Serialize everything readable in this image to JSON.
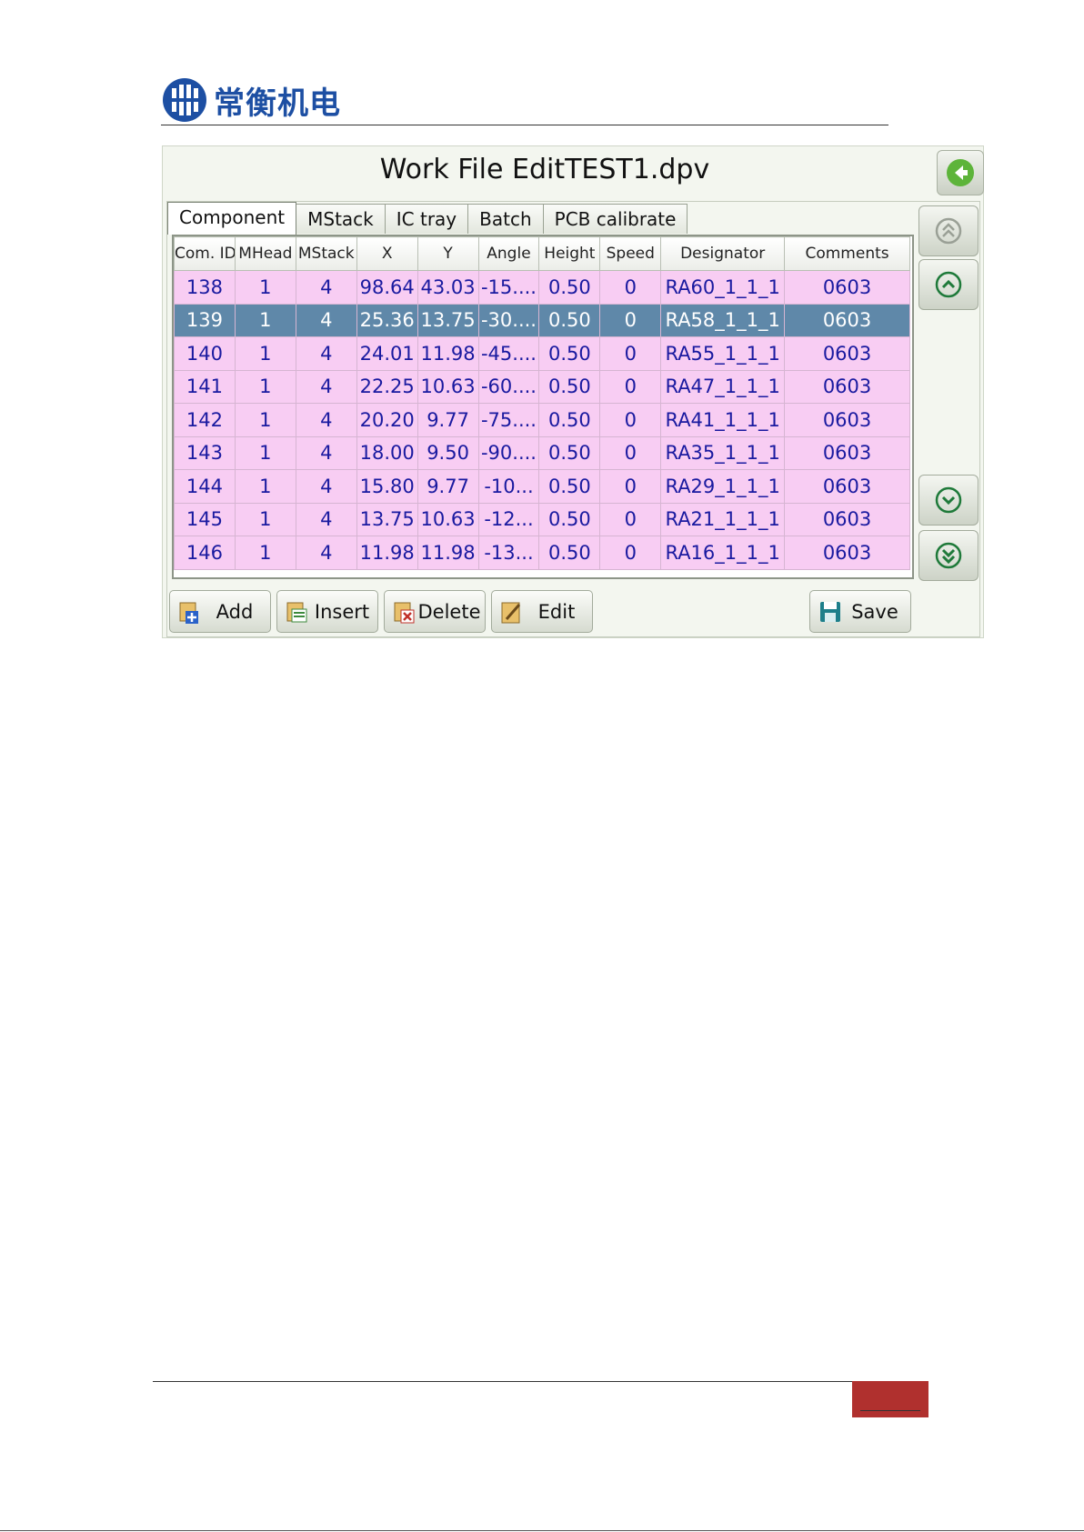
{
  "doc": {
    "logo_text": "常衡机电",
    "brand_color": "#1d4fa3",
    "footer_accent": "#b0302e"
  },
  "screen": {
    "title": "Work File EditTEST1.dpv",
    "tabs": [
      "Component",
      "MStack",
      "IC tray",
      "Batch",
      "PCB calibrate"
    ],
    "active_tab": "Component",
    "columns": [
      "Com. ID",
      "MHead",
      "MStack",
      "X",
      "Y",
      "Angle",
      "Height",
      "Speed",
      "Designator",
      "Comments"
    ],
    "rows": [
      {
        "id": "138",
        "mhead": "1",
        "mstack": "4",
        "x": "98.64",
        "y": "43.03",
        "angle": "-15....",
        "height": "0.50",
        "speed": "0",
        "designator": "RA60_1_1_1",
        "comments": "0603"
      },
      {
        "id": "139",
        "mhead": "1",
        "mstack": "4",
        "x": "25.36",
        "y": "13.75",
        "angle": "-30....",
        "height": "0.50",
        "speed": "0",
        "designator": "RA58_1_1_1",
        "comments": "0603"
      },
      {
        "id": "140",
        "mhead": "1",
        "mstack": "4",
        "x": "24.01",
        "y": "11.98",
        "angle": "-45....",
        "height": "0.50",
        "speed": "0",
        "designator": "RA55_1_1_1",
        "comments": "0603"
      },
      {
        "id": "141",
        "mhead": "1",
        "mstack": "4",
        "x": "22.25",
        "y": "10.63",
        "angle": "-60....",
        "height": "0.50",
        "speed": "0",
        "designator": "RA47_1_1_1",
        "comments": "0603"
      },
      {
        "id": "142",
        "mhead": "1",
        "mstack": "4",
        "x": "20.20",
        "y": "9.77",
        "angle": "-75....",
        "height": "0.50",
        "speed": "0",
        "designator": "RA41_1_1_1",
        "comments": "0603"
      },
      {
        "id": "143",
        "mhead": "1",
        "mstack": "4",
        "x": "18.00",
        "y": "9.50",
        "angle": "-90....",
        "height": "0.50",
        "speed": "0",
        "designator": "RA35_1_1_1",
        "comments": "0603"
      },
      {
        "id": "144",
        "mhead": "1",
        "mstack": "4",
        "x": "15.80",
        "y": "9.77",
        "angle": "-10...",
        "height": "0.50",
        "speed": "0",
        "designator": "RA29_1_1_1",
        "comments": "0603"
      },
      {
        "id": "145",
        "mhead": "1",
        "mstack": "4",
        "x": "13.75",
        "y": "10.63",
        "angle": "-12...",
        "height": "0.50",
        "speed": "0",
        "designator": "RA21_1_1_1",
        "comments": "0603"
      },
      {
        "id": "146",
        "mhead": "1",
        "mstack": "4",
        "x": "11.98",
        "y": "11.98",
        "angle": "-13...",
        "height": "0.50",
        "speed": "0",
        "designator": "RA16_1_1_1",
        "comments": "0603"
      }
    ],
    "selected_row_id": "139",
    "row_color": "#f8cdf3",
    "selected_row_color": "#5f88a9",
    "row_text_color": "#1a1aa0",
    "buttons": {
      "add": "Add",
      "insert": "Insert",
      "delete": "Delete",
      "edit": "Edit",
      "save": "Save"
    },
    "icons": [
      "back-arrow-icon",
      "double-up-icon",
      "up-icon",
      "down-icon",
      "double-down-icon"
    ]
  }
}
